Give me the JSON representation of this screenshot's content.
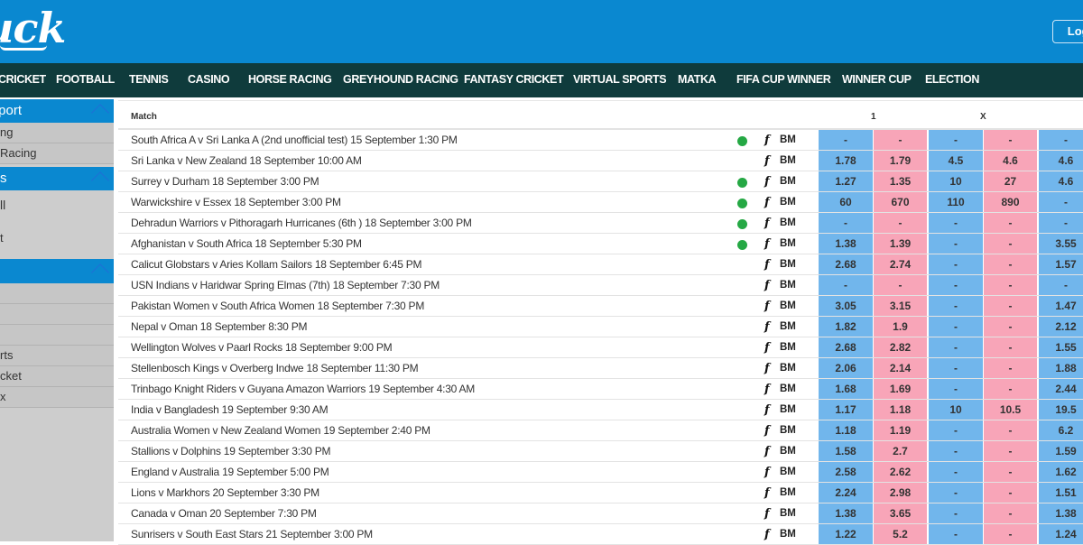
{
  "header": {
    "logo_text": "uck",
    "login_label": "Login"
  },
  "nav": {
    "items": [
      "CRICKET",
      "FOOTBALL",
      "TENNIS",
      "CASINO",
      "HORSE RACING",
      "GREYHOUND RACING",
      "FANTASY CRICKET",
      "VIRTUAL SPORTS",
      "MATKA",
      "FIFA CUP WINNER",
      "WINNER CUP",
      "ELECTION"
    ]
  },
  "sidebar": {
    "sections": [
      {
        "title": "port",
        "items": [
          "ng",
          "Racing"
        ]
      },
      {
        "title": "s",
        "items": [
          "ll",
          "t"
        ]
      },
      {
        "title": "",
        "items": [
          "",
          "",
          "",
          "rts",
          "cket",
          "x"
        ]
      }
    ]
  },
  "table": {
    "header_match": "Match",
    "header_1": "1",
    "header_x": "X",
    "rows": [
      {
        "match": "South Africa A v Sri Lanka A (2nd unofficial test) 15 September 1:30 PM",
        "live": true,
        "odds": [
          "-",
          "-",
          "-",
          "-",
          "-"
        ]
      },
      {
        "match": "Sri Lanka v New Zealand 18 September 10:00 AM",
        "live": false,
        "odds": [
          "1.78",
          "1.79",
          "4.5",
          "4.6",
          "4.6"
        ]
      },
      {
        "match": "Surrey v Durham 18 September 3:00 PM",
        "live": true,
        "odds": [
          "1.27",
          "1.35",
          "10",
          "27",
          "4.6"
        ]
      },
      {
        "match": "Warwickshire v Essex 18 September 3:00 PM",
        "live": true,
        "odds": [
          "60",
          "670",
          "110",
          "890",
          "-"
        ]
      },
      {
        "match": "Dehradun Warriors v Pithoragarh Hurricanes (6th ) 18 September 3:00 PM",
        "live": true,
        "odds": [
          "-",
          "-",
          "-",
          "-",
          "-"
        ]
      },
      {
        "match": "Afghanistan v South Africa 18 September 5:30 PM",
        "live": true,
        "odds": [
          "1.38",
          "1.39",
          "-",
          "-",
          "3.55"
        ]
      },
      {
        "match": "Calicut Globstars v Aries Kollam Sailors 18 September 6:45 PM",
        "live": false,
        "odds": [
          "2.68",
          "2.74",
          "-",
          "-",
          "1.57"
        ]
      },
      {
        "match": "USN Indians v Haridwar Spring Elmas (7th) 18 September 7:30 PM",
        "live": false,
        "odds": [
          "-",
          "-",
          "-",
          "-",
          "-"
        ]
      },
      {
        "match": "Pakistan Women v South Africa Women 18 September 7:30 PM",
        "live": false,
        "odds": [
          "3.05",
          "3.15",
          "-",
          "-",
          "1.47"
        ]
      },
      {
        "match": "Nepal v Oman 18 September 8:30 PM",
        "live": false,
        "odds": [
          "1.82",
          "1.9",
          "-",
          "-",
          "2.12"
        ]
      },
      {
        "match": "Wellington Wolves v Paarl Rocks 18 September 9:00 PM",
        "live": false,
        "odds": [
          "2.68",
          "2.82",
          "-",
          "-",
          "1.55"
        ]
      },
      {
        "match": "Stellenbosch Kings v Overberg Indwe 18 September 11:30 PM",
        "live": false,
        "odds": [
          "2.06",
          "2.14",
          "-",
          "-",
          "1.88"
        ]
      },
      {
        "match": "Trinbago Knight Riders v Guyana Amazon Warriors 19 September 4:30 AM",
        "live": false,
        "odds": [
          "1.68",
          "1.69",
          "-",
          "-",
          "2.44"
        ]
      },
      {
        "match": "India v Bangladesh 19 September 9:30 AM",
        "live": false,
        "odds": [
          "1.17",
          "1.18",
          "10",
          "10.5",
          "19.5"
        ]
      },
      {
        "match": "Australia Women v New Zealand Women 19 September 2:40 PM",
        "live": false,
        "odds": [
          "1.18",
          "1.19",
          "-",
          "-",
          "6.2"
        ]
      },
      {
        "match": "Stallions v Dolphins 19 September 3:30 PM",
        "live": false,
        "odds": [
          "1.58",
          "2.7",
          "-",
          "-",
          "1.59"
        ]
      },
      {
        "match": "England v Australia 19 September 5:00 PM",
        "live": false,
        "odds": [
          "2.58",
          "2.62",
          "-",
          "-",
          "1.62"
        ]
      },
      {
        "match": "Lions v Markhors 20 September 3:30 PM",
        "live": false,
        "odds": [
          "2.24",
          "2.98",
          "-",
          "-",
          "1.51"
        ]
      },
      {
        "match": "Canada v Oman 20 September 7:30 PM",
        "live": false,
        "odds": [
          "1.38",
          "3.65",
          "-",
          "-",
          "1.38"
        ]
      },
      {
        "match": "Sunrisers v South East Stars 21 September 3:00 PM",
        "live": false,
        "odds": [
          "1.22",
          "5.2",
          "-",
          "-",
          "1.24"
        ]
      }
    ],
    "fb_label": "f",
    "bm_label": "BM"
  },
  "colors": {
    "header_blue": "#0a88d0",
    "nav_dark": "#0f3b3c",
    "back_blue": "#71b6ec",
    "lay_pink": "#f8a5b8",
    "live_green": "#25a844"
  }
}
